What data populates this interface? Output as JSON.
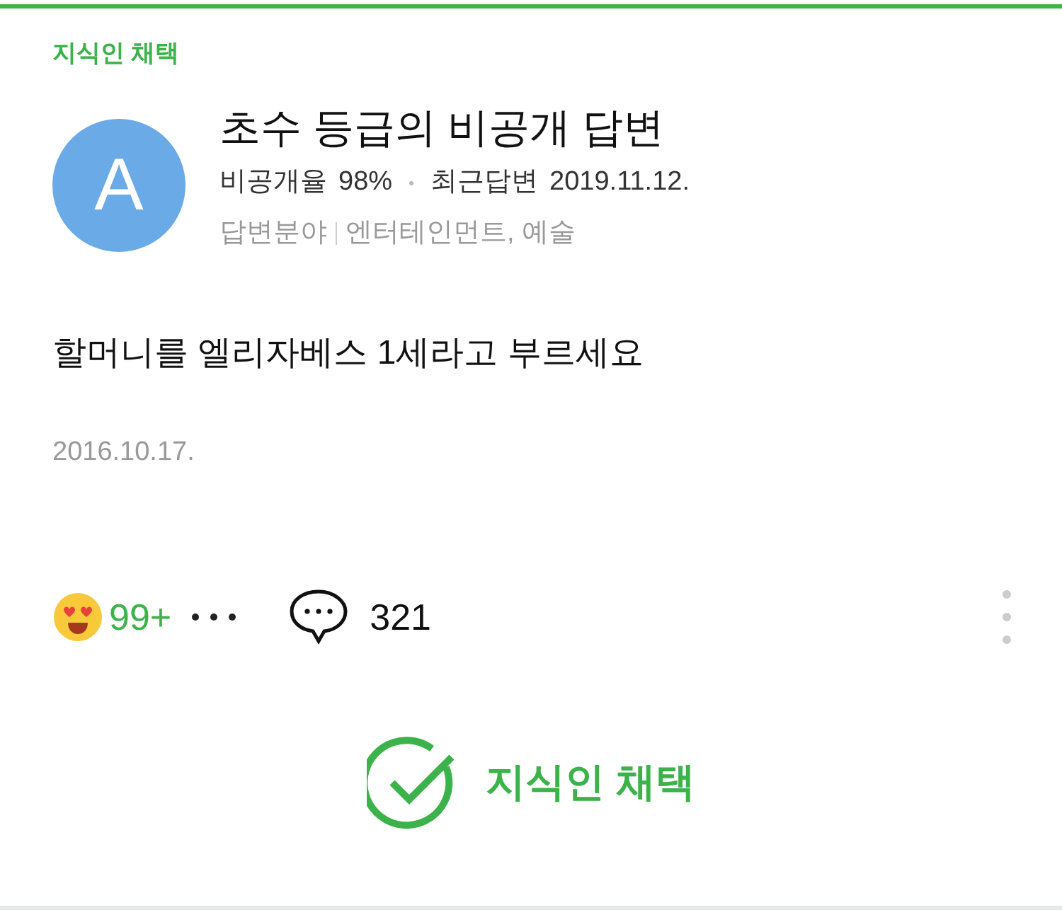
{
  "badge": "지식인 채택",
  "profile": {
    "avatar_letter": "A",
    "title": "초수 등급의 비공개 답변",
    "private_rate_label": "비공개율",
    "private_rate": "98%",
    "recent_label": "최근답변",
    "recent_date": "2019.11.12.",
    "field_label": "답변분야",
    "fields": "엔터테인먼트, 예술"
  },
  "answer": {
    "text": "할머니를 엘리자베스 1세라고 부르세요",
    "date": "2016.10.17."
  },
  "reactions": {
    "count": "99+",
    "comments": "321"
  },
  "adopt_button": "지식인 채택"
}
